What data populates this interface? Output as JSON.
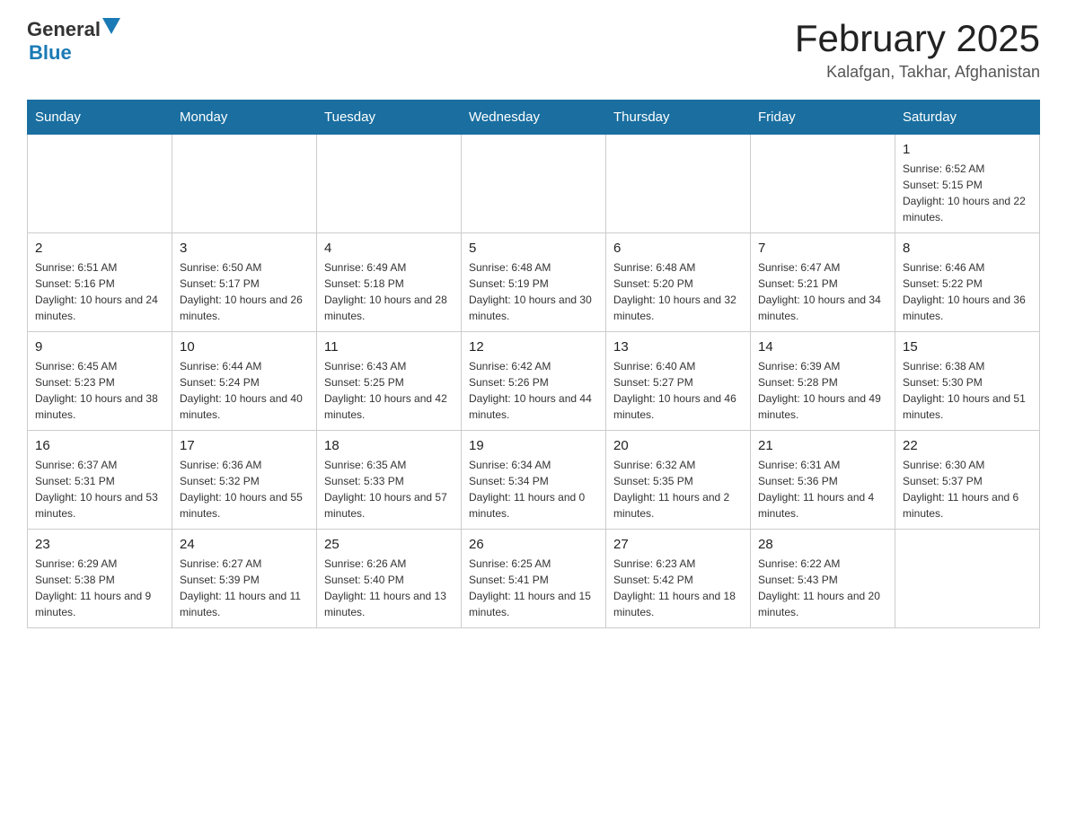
{
  "header": {
    "logo_general": "General",
    "logo_blue": "Blue",
    "title": "February 2025",
    "subtitle": "Kalafgan, Takhar, Afghanistan"
  },
  "days_of_week": [
    "Sunday",
    "Monday",
    "Tuesday",
    "Wednesday",
    "Thursday",
    "Friday",
    "Saturday"
  ],
  "weeks": [
    [
      {
        "day": "",
        "info": ""
      },
      {
        "day": "",
        "info": ""
      },
      {
        "day": "",
        "info": ""
      },
      {
        "day": "",
        "info": ""
      },
      {
        "day": "",
        "info": ""
      },
      {
        "day": "",
        "info": ""
      },
      {
        "day": "1",
        "info": "Sunrise: 6:52 AM\nSunset: 5:15 PM\nDaylight: 10 hours and 22 minutes."
      }
    ],
    [
      {
        "day": "2",
        "info": "Sunrise: 6:51 AM\nSunset: 5:16 PM\nDaylight: 10 hours and 24 minutes."
      },
      {
        "day": "3",
        "info": "Sunrise: 6:50 AM\nSunset: 5:17 PM\nDaylight: 10 hours and 26 minutes."
      },
      {
        "day": "4",
        "info": "Sunrise: 6:49 AM\nSunset: 5:18 PM\nDaylight: 10 hours and 28 minutes."
      },
      {
        "day": "5",
        "info": "Sunrise: 6:48 AM\nSunset: 5:19 PM\nDaylight: 10 hours and 30 minutes."
      },
      {
        "day": "6",
        "info": "Sunrise: 6:48 AM\nSunset: 5:20 PM\nDaylight: 10 hours and 32 minutes."
      },
      {
        "day": "7",
        "info": "Sunrise: 6:47 AM\nSunset: 5:21 PM\nDaylight: 10 hours and 34 minutes."
      },
      {
        "day": "8",
        "info": "Sunrise: 6:46 AM\nSunset: 5:22 PM\nDaylight: 10 hours and 36 minutes."
      }
    ],
    [
      {
        "day": "9",
        "info": "Sunrise: 6:45 AM\nSunset: 5:23 PM\nDaylight: 10 hours and 38 minutes."
      },
      {
        "day": "10",
        "info": "Sunrise: 6:44 AM\nSunset: 5:24 PM\nDaylight: 10 hours and 40 minutes."
      },
      {
        "day": "11",
        "info": "Sunrise: 6:43 AM\nSunset: 5:25 PM\nDaylight: 10 hours and 42 minutes."
      },
      {
        "day": "12",
        "info": "Sunrise: 6:42 AM\nSunset: 5:26 PM\nDaylight: 10 hours and 44 minutes."
      },
      {
        "day": "13",
        "info": "Sunrise: 6:40 AM\nSunset: 5:27 PM\nDaylight: 10 hours and 46 minutes."
      },
      {
        "day": "14",
        "info": "Sunrise: 6:39 AM\nSunset: 5:28 PM\nDaylight: 10 hours and 49 minutes."
      },
      {
        "day": "15",
        "info": "Sunrise: 6:38 AM\nSunset: 5:30 PM\nDaylight: 10 hours and 51 minutes."
      }
    ],
    [
      {
        "day": "16",
        "info": "Sunrise: 6:37 AM\nSunset: 5:31 PM\nDaylight: 10 hours and 53 minutes."
      },
      {
        "day": "17",
        "info": "Sunrise: 6:36 AM\nSunset: 5:32 PM\nDaylight: 10 hours and 55 minutes."
      },
      {
        "day": "18",
        "info": "Sunrise: 6:35 AM\nSunset: 5:33 PM\nDaylight: 10 hours and 57 minutes."
      },
      {
        "day": "19",
        "info": "Sunrise: 6:34 AM\nSunset: 5:34 PM\nDaylight: 11 hours and 0 minutes."
      },
      {
        "day": "20",
        "info": "Sunrise: 6:32 AM\nSunset: 5:35 PM\nDaylight: 11 hours and 2 minutes."
      },
      {
        "day": "21",
        "info": "Sunrise: 6:31 AM\nSunset: 5:36 PM\nDaylight: 11 hours and 4 minutes."
      },
      {
        "day": "22",
        "info": "Sunrise: 6:30 AM\nSunset: 5:37 PM\nDaylight: 11 hours and 6 minutes."
      }
    ],
    [
      {
        "day": "23",
        "info": "Sunrise: 6:29 AM\nSunset: 5:38 PM\nDaylight: 11 hours and 9 minutes."
      },
      {
        "day": "24",
        "info": "Sunrise: 6:27 AM\nSunset: 5:39 PM\nDaylight: 11 hours and 11 minutes."
      },
      {
        "day": "25",
        "info": "Sunrise: 6:26 AM\nSunset: 5:40 PM\nDaylight: 11 hours and 13 minutes."
      },
      {
        "day": "26",
        "info": "Sunrise: 6:25 AM\nSunset: 5:41 PM\nDaylight: 11 hours and 15 minutes."
      },
      {
        "day": "27",
        "info": "Sunrise: 6:23 AM\nSunset: 5:42 PM\nDaylight: 11 hours and 18 minutes."
      },
      {
        "day": "28",
        "info": "Sunrise: 6:22 AM\nSunset: 5:43 PM\nDaylight: 11 hours and 20 minutes."
      },
      {
        "day": "",
        "info": ""
      }
    ]
  ]
}
